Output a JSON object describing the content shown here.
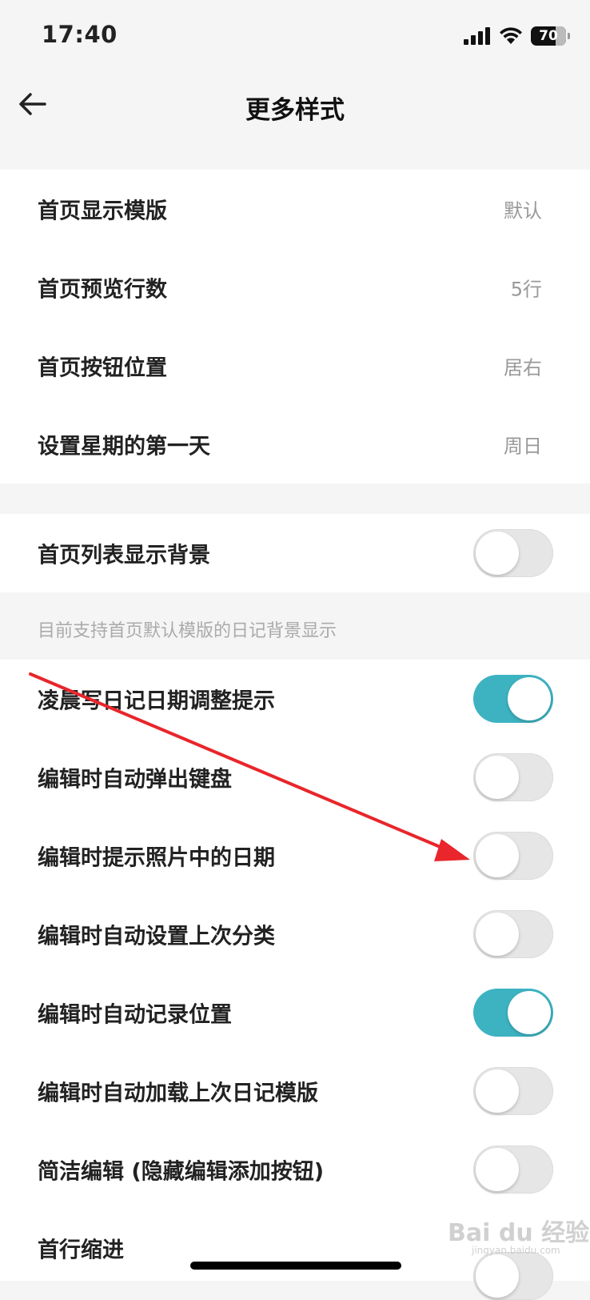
{
  "status_bar": {
    "time": "17:40",
    "battery": "70"
  },
  "nav": {
    "title": "更多样式"
  },
  "group1": [
    {
      "label": "首页显示模版",
      "value": "默认"
    },
    {
      "label": "首页预览行数",
      "value": "5行"
    },
    {
      "label": "首页按钮位置",
      "value": "居右"
    },
    {
      "label": "设置星期的第一天",
      "value": "周日"
    }
  ],
  "group2": {
    "label": "首页列表显示背景",
    "on": false,
    "hint": "目前支持首页默认模版的日记背景显示"
  },
  "group3": [
    {
      "label": "凌晨写日记日期调整提示",
      "on": true
    },
    {
      "label": "编辑时自动弹出键盘",
      "on": false
    },
    {
      "label": "编辑时提示照片中的日期",
      "on": false
    },
    {
      "label": "编辑时自动设置上次分类",
      "on": false
    },
    {
      "label": "编辑时自动记录位置",
      "on": true
    },
    {
      "label": "编辑时自动加载上次日记模版",
      "on": false
    },
    {
      "label": "简洁编辑 (隐藏编辑添加按钮)",
      "on": false
    },
    {
      "label": "首行缩进",
      "on": false
    }
  ],
  "colors": {
    "toggle_on": "#3db3c2",
    "annotation": "#e8262b"
  },
  "icons": [
    "back-arrow-icon",
    "signal-icon",
    "wifi-icon",
    "battery-icon"
  ],
  "watermark": {
    "text": "Bai du 经验",
    "sub": "jingyan.baidu.com"
  }
}
